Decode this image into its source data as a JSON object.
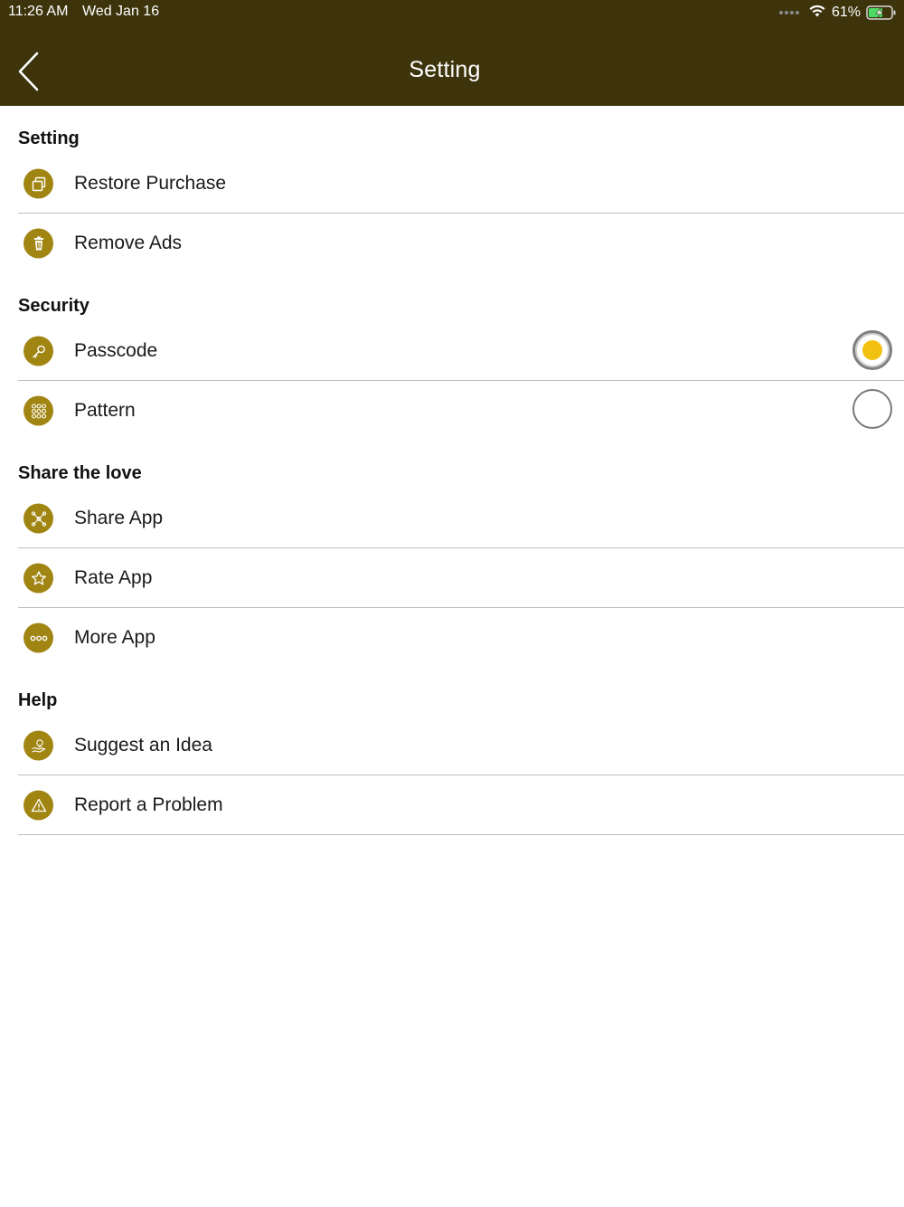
{
  "status_bar": {
    "time": "11:26 AM",
    "date": "Wed Jan 16",
    "battery": "61%"
  },
  "nav": {
    "title": "Setting"
  },
  "colors": {
    "header_bg": "#3d340c",
    "icon_bg": "#a18512",
    "radio_selected": "#f2c00e"
  },
  "sections": [
    {
      "title": "Setting",
      "items": [
        {
          "label": "Restore Purchase",
          "icon": "restore-icon"
        },
        {
          "label": "Remove Ads",
          "icon": "trash-icon"
        }
      ]
    },
    {
      "title": "Security",
      "items": [
        {
          "label": "Passcode",
          "icon": "key-icon",
          "selected": true
        },
        {
          "label": "Pattern",
          "icon": "pattern-grid-icon",
          "selected": false
        }
      ]
    },
    {
      "title": "Share the love",
      "items": [
        {
          "label": "Share App",
          "icon": "share-icon"
        },
        {
          "label": "Rate App",
          "icon": "star-icon"
        },
        {
          "label": "More App",
          "icon": "more-dots-icon"
        }
      ]
    },
    {
      "title": "Help",
      "items": [
        {
          "label": "Suggest an Idea",
          "icon": "lightbulb-hand-icon"
        },
        {
          "label": "Report a Problem",
          "icon": "warning-icon"
        }
      ]
    }
  ]
}
